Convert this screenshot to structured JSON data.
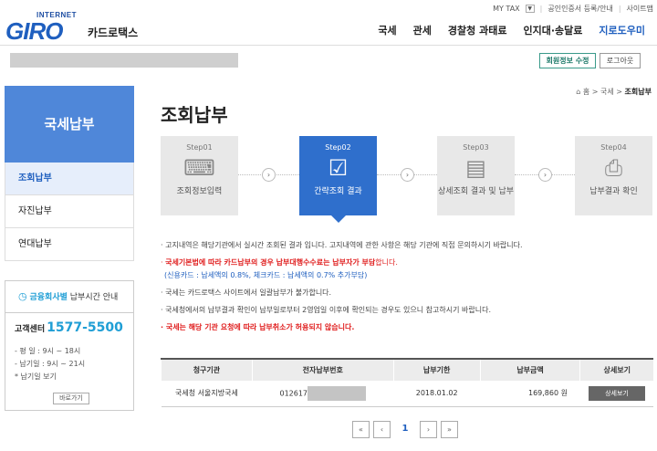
{
  "header": {
    "logo_internet": "INTERNET",
    "logo_giro": "GIRO",
    "logo_korean": "카드로택스",
    "util": [
      "MY TAX",
      "공인인증서 등록/안내",
      "사이트맵"
    ],
    "gnb": [
      "국세",
      "관세",
      "경찰청 과태료",
      "인지대·송달료",
      "지로도우미"
    ],
    "member_edit": "회원정보 수정",
    "logout": "로그아웃"
  },
  "sidebar": {
    "title": "국세납부",
    "items": [
      "조회납부",
      "자진납부",
      "연대납부"
    ],
    "fin_hours": {
      "a": "금융회사별",
      "b": "납부시간 안내"
    },
    "cs": {
      "title": "고객센터",
      "number": "1577-5500",
      "line1": "- 평    일 : 9시 ~ 18시",
      "line2": "- 납기일 : 9시 ~ 21시",
      "line3": "* 납기일 보기",
      "btn": "바로가기"
    }
  },
  "breadcrumb": {
    "home": "홈",
    "l1": "국세",
    "current": "조회납부"
  },
  "page_title": "조회납부",
  "steps": [
    {
      "num": "Step01",
      "label": "조회정보입력"
    },
    {
      "num": "Step02",
      "label": "간략조회 결과"
    },
    {
      "num": "Step03",
      "label": "상세조회 결과 및 납부"
    },
    {
      "num": "Step04",
      "label": "납부결과 확인"
    }
  ],
  "notes": {
    "n1": "고지내역은 해당기관에서 실시간 조회된 결과 입니다. 고지내역에 관한 사항은 해당 기관에 직접 문의하시기 바랍니다.",
    "n2a": "국세기본법에 따라 카드납부의 경우 납부대행수수료는 납부자가 부담",
    "n2b": "합니다.",
    "n2sub": "(신용카드 : 납세액의 0.8%, 체크카드 : 납세액의 0.7% 추가부담)",
    "n3": "국세는 카드로택스 사이트에서 일괄납부가 불가합니다.",
    "n4": "국세청에서의 납부결과 확인이 납부일로부터 2영업일 이후에 확인되는 경우도 있으니 참고하시기 바랍니다.",
    "n5": "국세는 해당 기관 요청에 따라 납부취소가 허용되지 않습니다."
  },
  "table": {
    "headers": [
      "청구기관",
      "전자납부번호",
      "납부기한",
      "납부금액",
      "상세보기"
    ],
    "row": {
      "org": "국세청 서울지방국세",
      "ebill_prefix": "012617",
      "due": "2018.01.02",
      "amount": "169,860 원",
      "detail": "상세보기"
    }
  },
  "pager": {
    "first": "«",
    "prev": "‹",
    "page": "1",
    "next": "›",
    "last": "»"
  }
}
